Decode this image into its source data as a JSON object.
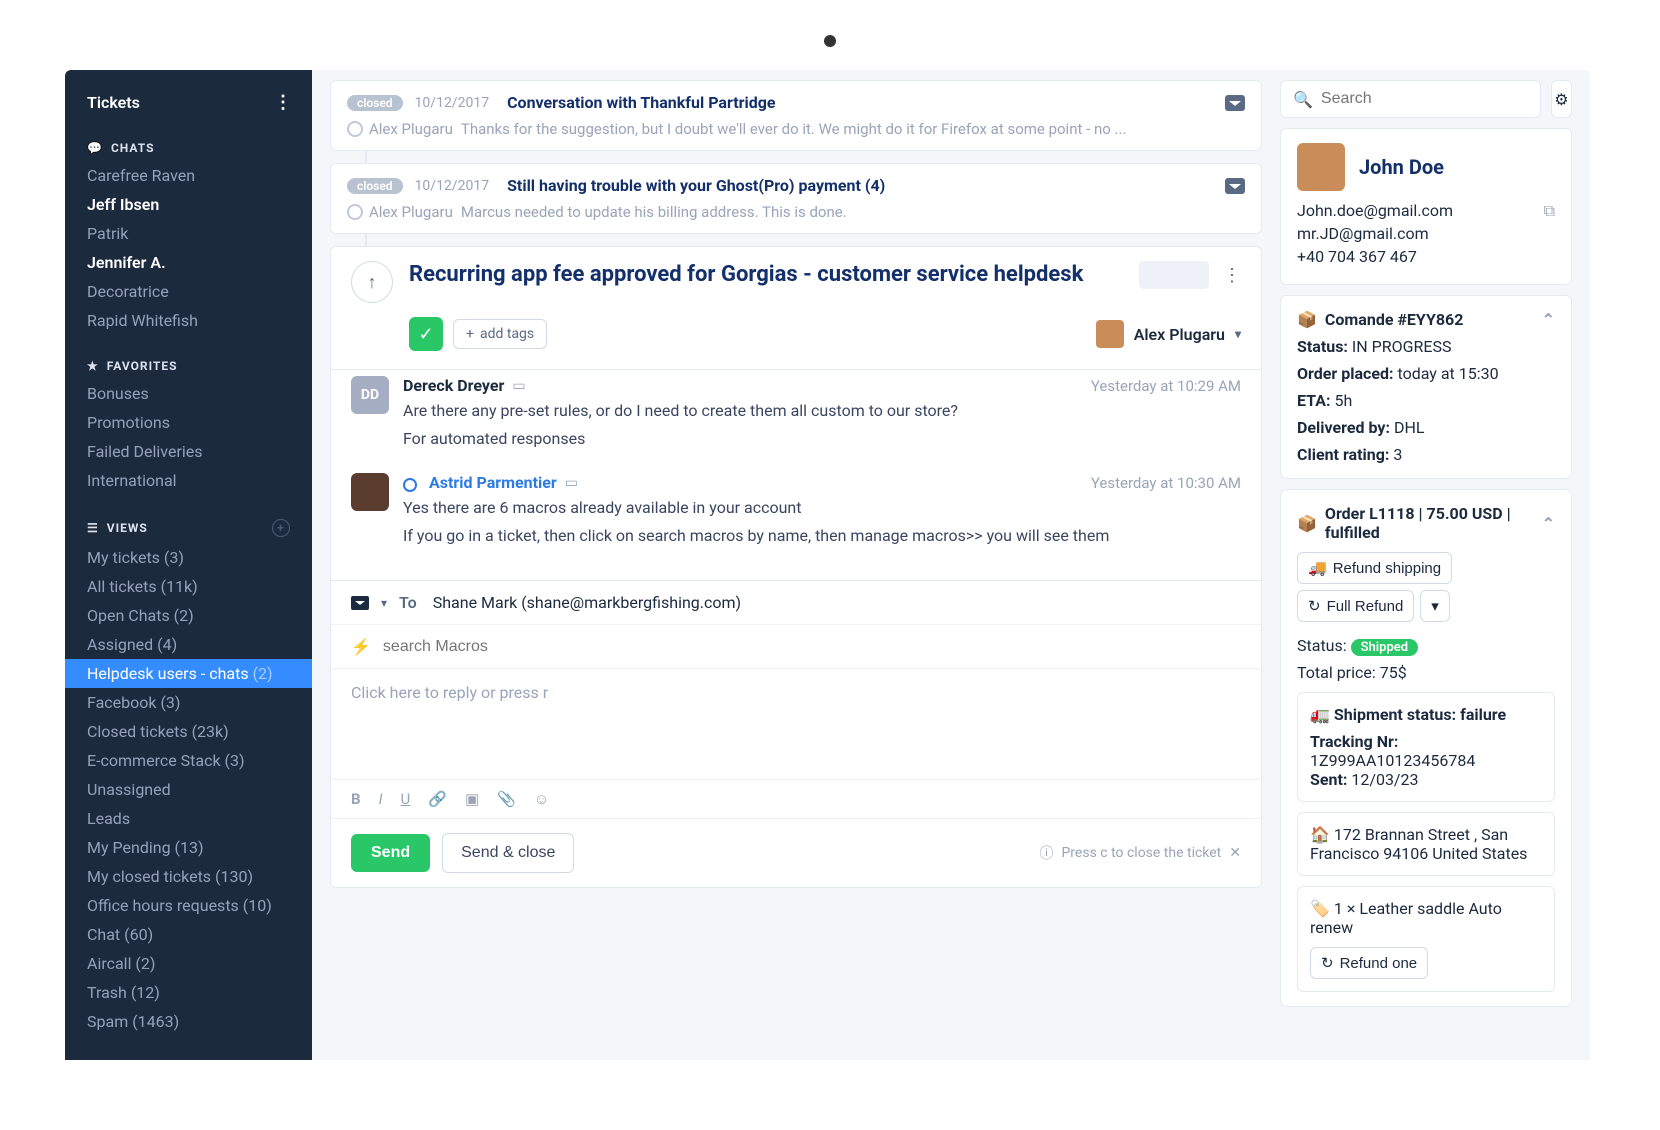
{
  "sidebar": {
    "title": "Tickets",
    "chats_label": "CHATS",
    "chats": [
      "Carefree Raven",
      "Jeff Ibsen",
      "Patrik",
      "Jennifer A.",
      "Decoratrice",
      "Rapid Whitefish"
    ],
    "chats_bold": [
      false,
      true,
      false,
      true,
      false,
      false
    ],
    "fav_label": "FAVORITES",
    "favorites": [
      "Bonuses",
      "Promotions",
      "Failed Deliveries",
      "International"
    ],
    "views_label": "VIEWS",
    "views": [
      {
        "label": "My tickets (3)",
        "active": false
      },
      {
        "label": "All tickets (11k)",
        "active": false
      },
      {
        "label": "Open Chats (2)",
        "active": false
      },
      {
        "label": "Assigned (4)",
        "active": false
      },
      {
        "label": "Helpdesk users - chats",
        "count": "(2)",
        "active": true
      },
      {
        "label": "Facebook (3)",
        "active": false
      },
      {
        "label": "Closed tickets (23k)",
        "active": false
      },
      {
        "label": "E-commerce Stack (3)",
        "active": false
      },
      {
        "label": "Unassigned",
        "active": false
      },
      {
        "label": "Leads",
        "active": false
      },
      {
        "label": "My Pending (13)",
        "active": false
      },
      {
        "label": "My closed tickets (130)",
        "active": false
      },
      {
        "label": "Office hours requests (10)",
        "active": false
      },
      {
        "label": "Chat (60)",
        "active": false
      },
      {
        "label": "Aircall (2)",
        "active": false
      },
      {
        "label": "Trash (12)",
        "active": false
      },
      {
        "label": "Spam (1463)",
        "active": false
      }
    ]
  },
  "tickets": [
    {
      "status": "closed",
      "date": "10/12/2017",
      "title": "Conversation with Thankful Partridge",
      "author": "Alex Plugaru",
      "preview": "Thanks for the suggestion, but I doubt we'll ever do it. We might do it for Firefox at some point - no ..."
    },
    {
      "status": "closed",
      "date": "10/12/2017",
      "title": "Still having trouble with your Ghost(Pro) payment (4)",
      "author": "Alex Plugaru",
      "preview": "Marcus needed to update his billing address. This is done."
    }
  ],
  "active": {
    "title": "Recurring app fee approved for Gorgias - customer service helpdesk",
    "add_tags": "add tags",
    "assignee": "Alex Plugaru"
  },
  "messages": [
    {
      "initials": "DD",
      "name": "Dereck Dreyer",
      "link": false,
      "time": "Yesterday at 10:29 AM",
      "lines": [
        "Are there any pre-set rules, or do I need to create them all custom to our store?",
        "For automated responses"
      ]
    },
    {
      "initials": "",
      "name": "Astrid Parmentier",
      "link": true,
      "time": "Yesterday at 10:30 AM",
      "lines": [
        "Yes there are 6 macros already available in your account",
        "If you go in a ticket, then click on search macros by name, then manage macros>> you will see them"
      ]
    }
  ],
  "compose": {
    "to_label": "To",
    "to_value": "Shane Mark (shane@markbergfishing.com)",
    "macros_placeholder": "search Macros",
    "body_placeholder": "Click here to reply or press r",
    "send": "Send",
    "send_close": "Send & close",
    "hint": "Press c to close the ticket"
  },
  "right": {
    "search_placeholder": "Search",
    "profile": {
      "name": "John Doe",
      "email1": "John.doe@gmail.com",
      "email2": "mr.JD@gmail.com",
      "phone": "+40 704 367 467"
    },
    "order1": {
      "title": "Comande #EYY862",
      "status_label": "Status:",
      "status": "IN PROGRESS",
      "placed_label": "Order placed:",
      "placed": "today at 15:30",
      "eta_label": "ETA:",
      "eta": "5h",
      "del_label": "Delivered by:",
      "del": "DHL",
      "rating_label": "Client rating:",
      "rating": "3"
    },
    "order2": {
      "title": "Order L1118 | 75.00 USD | fulfilled",
      "refund_ship": "Refund shipping",
      "full_refund": "Full Refund",
      "status_label": "Status:",
      "status_pill": "Shipped",
      "total_label": "Total price:",
      "total": "75$",
      "ship_title": "Shipment status: failure",
      "track_label": "Tracking Nr:",
      "track": "1Z999AA10123456784",
      "sent_label": "Sent:",
      "sent": "12/03/23",
      "address": "172 Brannan Street , San Francisco 94106 United States",
      "item": "1 × Leather saddle Auto renew",
      "refund_one": "Refund one"
    }
  }
}
